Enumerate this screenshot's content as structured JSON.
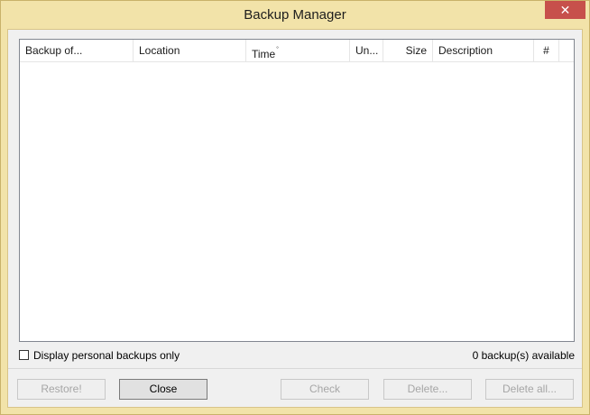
{
  "window": {
    "title": "Backup Manager",
    "close_glyph": "✕"
  },
  "list": {
    "columns": [
      {
        "label": "Backup of..."
      },
      {
        "label": "Location"
      },
      {
        "label": "Time",
        "sort_indicator": "˚"
      },
      {
        "label": "Un..."
      },
      {
        "label": "Size"
      },
      {
        "label": "Description"
      },
      {
        "label": "#"
      }
    ],
    "rows": []
  },
  "footer": {
    "checkbox_label": "Display personal backups only",
    "checkbox_checked": false,
    "backup_count": "0 backup(s) available"
  },
  "buttons": {
    "restore": "Restore!",
    "close": "Close",
    "check": "Check",
    "delete": "Delete...",
    "delete_all": "Delete all..."
  },
  "colors": {
    "title_bar": "#f2e3a9",
    "close_button": "#c7504b"
  }
}
